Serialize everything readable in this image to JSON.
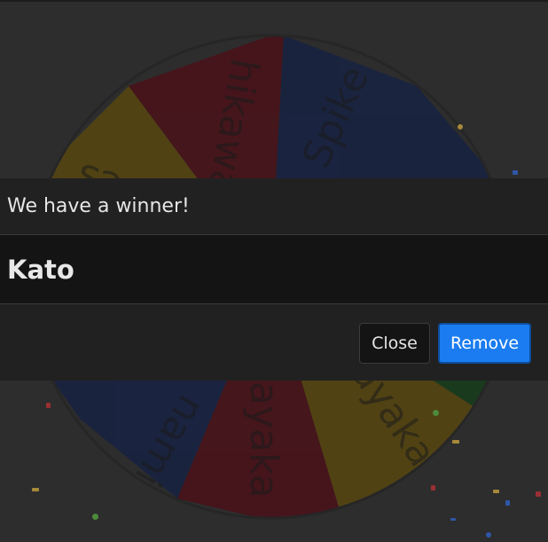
{
  "wheel": {
    "segments": [
      {
        "label": "Spike",
        "color": "#172243"
      },
      {
        "label": "",
        "color": "#172243"
      },
      {
        "label": "",
        "color": "#163d1c"
      },
      {
        "label": "ayaka",
        "color": "#59470f"
      },
      {
        "label": "ayaka",
        "color": "#4b1118"
      },
      {
        "label": "nami",
        "color": "#172243"
      },
      {
        "label": "",
        "color": "#59470f"
      },
      {
        "label": "es",
        "color": "#59470f"
      },
      {
        "label": "hikawa",
        "color": "#4b1118"
      }
    ]
  },
  "modal": {
    "title": "We have a winner!",
    "winner": "Kato",
    "close_label": "Close",
    "remove_label": "Remove"
  },
  "colors": {
    "accent": "#1a7cf0",
    "modal_bg": "#212121",
    "body_bg": "#141414"
  }
}
